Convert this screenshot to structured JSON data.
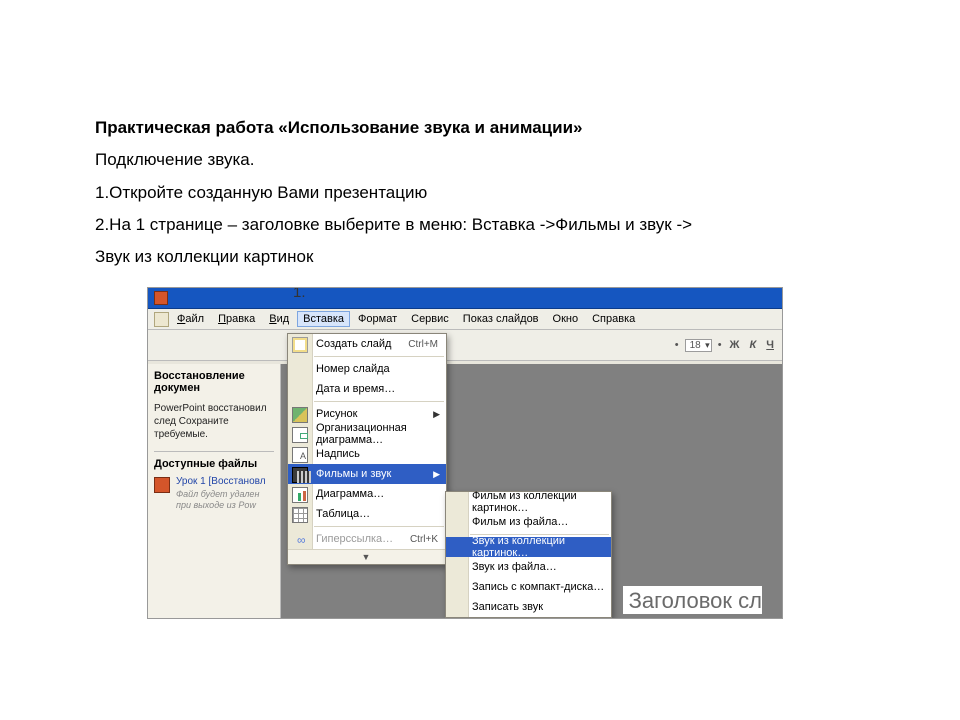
{
  "doc": {
    "heading": "Практическая работа «Использование звука и анимации»",
    "line1": "Подключение звука.",
    "line2": "1.Откройте созданную Вами презентацию",
    "line3": "2.На 1 странице – заголовке выберите в меню: Вставка ->Фильмы и звук ->",
    "line4": "Звук из коллекции картинок"
  },
  "fig_num": "1.",
  "menubar": {
    "file": "Файл",
    "edit": "Правка",
    "view": "Вид",
    "insert": "Вставка",
    "format": "Формат",
    "tools": "Сервис",
    "slideshow": "Показ слайдов",
    "window": "Окно",
    "help": "Справка"
  },
  "toolbar": {
    "font_size": "18",
    "bold": "Ж",
    "italic": "К",
    "underline": "Ч",
    "bullet": "•"
  },
  "task_pane": {
    "title": "Восстановление докумен",
    "note": "PowerPoint восстановил след\nСохраните требуемые.",
    "section": "Доступные файлы",
    "item_title": "Урок 1 [Восстановл",
    "item_sub": "Файл будет удален\nпри выходе из Pow"
  },
  "dropdown": {
    "new_slide": "Создать слайд",
    "new_slide_sc": "Ctrl+M",
    "slide_num": "Номер слайда",
    "date_time": "Дата и время…",
    "picture": "Рисунок",
    "org_chart": "Организационная диаграмма…",
    "textbox": "Надпись",
    "movies_sound": "Фильмы и звук",
    "chart": "Диаграмма…",
    "table": "Таблица…",
    "hyperlink": "Гиперссылка…",
    "hyperlink_sc": "Ctrl+K",
    "expand": "▾▾"
  },
  "submenu": {
    "movie_gallery": "Фильм из коллекции картинок…",
    "movie_file": "Фильм из файла…",
    "sound_gallery": "Звук из коллекции картинок…",
    "sound_file": "Звук из файла…",
    "cd_audio": "Запись с компакт-диска…",
    "record": "Записать звук"
  },
  "slide": {
    "title_placeholder": "Заголовок сл"
  }
}
